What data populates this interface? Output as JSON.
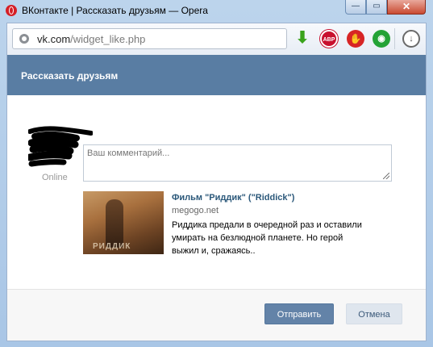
{
  "window": {
    "title": "ВКонтакте | Рассказать друзьям — Opera",
    "minimize_label": "—",
    "maximize_label": "▭",
    "close_label": "✕"
  },
  "address_bar": {
    "domain": "vk.com",
    "path": "/widget_like.php"
  },
  "toolbar": {
    "icons": [
      "download-arrow-icon",
      "adblock-plus-icon",
      "stop-hand-icon",
      "green-extension-icon",
      "download-circle-icon"
    ],
    "abp_label": "ABP"
  },
  "dialog": {
    "title": "Рассказать друзьям",
    "user_status": "Online",
    "comment_placeholder": "Ваш комментарий...",
    "link": {
      "title": "Фильм \"Риддик\" (\"Riddick\")",
      "domain": "megogo.net",
      "description": "Риддика предали в очередной раз и оставили умирать на безлюдной планете. Но герой выжил и, сражаясь..",
      "thumbnail_caption": "РИДДИК"
    },
    "buttons": {
      "send": "Отправить",
      "cancel": "Отмена"
    }
  },
  "colors": {
    "header_bg": "#597da3",
    "link_color": "#2b587a",
    "send_button": "#6383a8",
    "cancel_button": "#dfe6ee"
  }
}
